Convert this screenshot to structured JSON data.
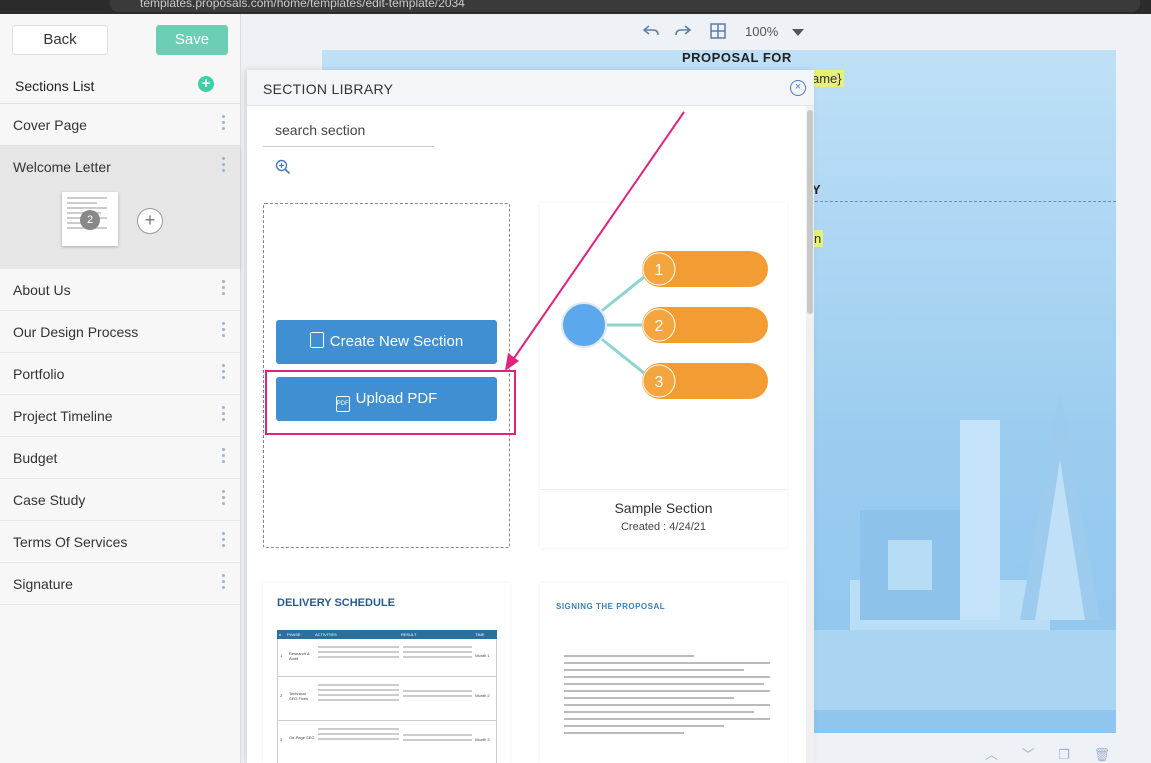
{
  "browser": {
    "url": "templates.proposals.com/home/templates/edit-template/2034"
  },
  "toolbar": {
    "back_label": "Back",
    "save_label": "Save",
    "zoom": "100%"
  },
  "sections": {
    "header": "Sections List",
    "items": [
      {
        "label": "Cover Page"
      },
      {
        "label": "Welcome Letter",
        "page_badge": "2"
      },
      {
        "label": "About Us"
      },
      {
        "label": "Our Design Process"
      },
      {
        "label": "Portfolio"
      },
      {
        "label": "Project Timeline"
      },
      {
        "label": "Budget"
      },
      {
        "label": "Case Study"
      },
      {
        "label": "Terms Of Services"
      },
      {
        "label": "Signature"
      }
    ]
  },
  "document": {
    "title": "PROPOSAL FOR",
    "placeholder_1": "ame}",
    "heading_fragment": "Y",
    "placeholder_2": "n"
  },
  "library": {
    "title": "SECTION LIBRARY",
    "search_placeholder": "search section",
    "create_label": "Create New Section",
    "upload_label": "Upload PDF",
    "upload_icon_text": "PDF",
    "sample": {
      "name": "Sample Section",
      "created": "Created : 4/24/21",
      "nodes": [
        "1",
        "2",
        "3"
      ]
    },
    "delivery": {
      "heading": "DELIVERY SCHEDULE",
      "columns": [
        "#",
        "PHASE",
        "ACTIVITIES",
        "RESULT",
        "TIME"
      ],
      "rows": [
        {
          "n": "1",
          "phase": "Research & Audit",
          "time": "Month 1"
        },
        {
          "n": "2",
          "phase": "Technical SEO Fixes",
          "time": "Month 2"
        },
        {
          "n": "3",
          "phase": "On-Page SEO",
          "time": "Month 3"
        }
      ]
    },
    "signing": {
      "heading": "SIGNING THE PROPOSAL"
    }
  },
  "colors": {
    "accent": "#3f8fd2",
    "save": "#6ccfb5",
    "highlight": "#e0237c",
    "orange": "#f39c34"
  }
}
